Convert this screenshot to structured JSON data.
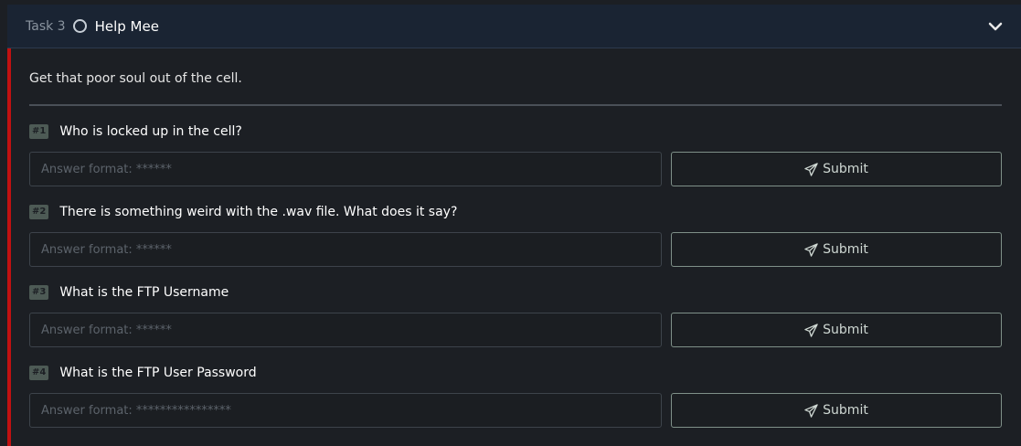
{
  "task": {
    "label": "Task 3",
    "title": "Help Mee",
    "intro": "Get that poor soul out of the cell."
  },
  "questions": [
    {
      "badge": "#1",
      "text": "Who is locked up in the cell?",
      "placeholder": "Answer format: ******",
      "submit_label": "Submit"
    },
    {
      "badge": "#2",
      "text": "There is something weird with the .wav file. What does it say?",
      "placeholder": "Answer format: ******",
      "submit_label": "Submit"
    },
    {
      "badge": "#3",
      "text": "What is the FTP Username",
      "placeholder": "Answer format: ******",
      "submit_label": "Submit"
    },
    {
      "badge": "#4",
      "text": "What is the FTP User Password",
      "placeholder": "Answer format: ****************",
      "submit_label": "Submit"
    }
  ],
  "colors": {
    "header_bg": "#1a2433",
    "body_bg": "#1c1f24",
    "accent_red": "#c11111",
    "badge_bg": "#4d5a55",
    "button_border": "#7f9089"
  },
  "icons": {
    "status": "circle-outline-icon",
    "expand": "chevron-down-icon",
    "submit": "paper-plane-icon"
  }
}
